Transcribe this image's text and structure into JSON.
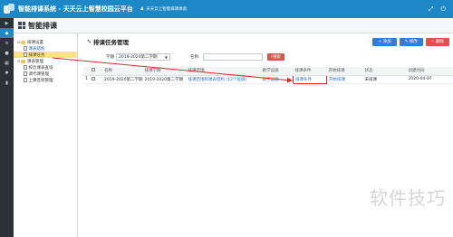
{
  "header": {
    "app_title": "智能排课系统 - 天天云上智慧校园云平台",
    "user_label": "天天云上智能排课体验",
    "icons": [
      "logo",
      "person-icon",
      "expand-icon",
      "power-icon"
    ]
  },
  "rail": {
    "icons": [
      "play-icon",
      "tag-icon",
      "list-icon",
      "user-icon",
      "grid-icon",
      "gear-icon",
      "chart-icon"
    ]
  },
  "panel": {
    "title": "智能排课"
  },
  "tree": {
    "nodes": [
      {
        "label": "排课设置",
        "level": 1,
        "type": "folder"
      },
      {
        "label": "课表结构",
        "level": 2,
        "type": "doc"
      },
      {
        "label": "排课任务",
        "level": 2,
        "type": "doc"
      },
      {
        "label": "课表管理",
        "level": 1,
        "type": "folder"
      },
      {
        "label": "校历课表查询",
        "level": 2,
        "type": "doc"
      },
      {
        "label": "调代课管理",
        "level": 2,
        "type": "doc"
      },
      {
        "label": "上课签到管理",
        "level": 2,
        "type": "doc"
      }
    ]
  },
  "main": {
    "title": "排课任务管理",
    "buttons": {
      "add": "+ 添加",
      "edit": "✎ 修改",
      "delete": "− 删除"
    },
    "filter": {
      "term_label": "学期",
      "term_value": "2019-2020第二学期",
      "name_label": "名称:",
      "search_label": "搜索"
    },
    "table": {
      "headers": [
        "",
        "",
        "名称",
        "排课学期",
        "排课范围",
        "教学设施",
        "排课条件",
        "开始排课",
        "状态",
        "创建时间"
      ],
      "rows": [
        [
          "1",
          "",
          "2019-2020第二学期",
          "2019-2020第二学期",
          "排课范围和课表结构 (12个班级)",
          "教学设施",
          "排课条件",
          "开始排课",
          "未排课",
          "2020-04-07"
        ]
      ]
    }
  },
  "watermark": "软件技巧",
  "colors": {
    "topbar": "#1e88c7",
    "rail": "#2b3238",
    "accent_red": "#e2282b",
    "link": "#2f6fd0"
  }
}
